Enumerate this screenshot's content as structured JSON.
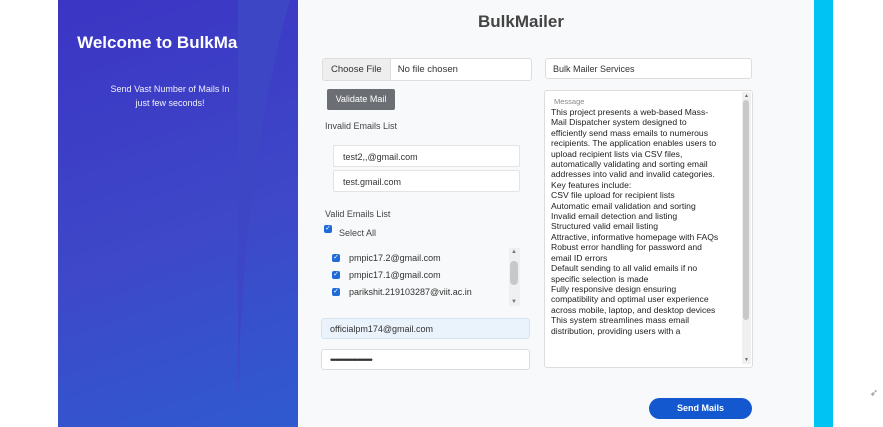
{
  "app": {
    "title": "BulkMailer",
    "welcome_title": "Welcome to BulkMailer",
    "welcome_subtitle": "Send Vast Number of Mails In just few seconds!"
  },
  "form": {
    "file_button_label": "Choose File",
    "file_status": "No file chosen",
    "validate_button_label": "Validate Mail",
    "invalid_emails_label": "Invalid Emails List",
    "invalid_emails": [
      "test2,,@gmail.com",
      "test.gmail.com"
    ],
    "valid_emails_label": "Valid Emails List",
    "select_all_label": "Select All",
    "valid_emails": [
      "pmpic17.2@gmail.com",
      "pmpic17.1@gmail.com",
      "parikshit.219103287@viit.ac.in"
    ],
    "sender_email": "officialpm174@gmail.com",
    "password_masked": "•••••••••••••••••••••••••",
    "subject": "Bulk Mailer Services",
    "message_placeholder": "Message",
    "message_body": "This project presents a web-based Mass-\nMail Dispatcher system designed to\nefficiently send mass emails to numerous\nrecipients. The application enables users to\nupload recipient lists via CSV files,\nautomatically validating and sorting email\naddresses into valid and invalid categories.\nKey features include:\nCSV file upload for recipient lists\nAutomatic email validation and sorting\nInvalid email detection and listing\nStructured valid email listing\nAttractive, informative homepage with FAQs\nRobust error handling for password and\nemail ID errors\nDefault sending to all valid emails if no\nspecific selection is made\nFully responsive design ensuring\ncompatibility and optimal user experience\nacross mobile, laptop, and desktop devices\nThis system streamlines mass email\ndistribution, providing users with a",
    "send_button_label": "Send Mails"
  },
  "icons": {
    "checkbox": "checkmark-icon",
    "side_action": "rocket-icon"
  },
  "colors": {
    "left_gradient_start": "#3b35c4",
    "left_gradient_end": "#2f5ad0",
    "send_button": "#1458cf",
    "right_bar": "#00c2f3",
    "validate_button": "#6b6e72"
  }
}
